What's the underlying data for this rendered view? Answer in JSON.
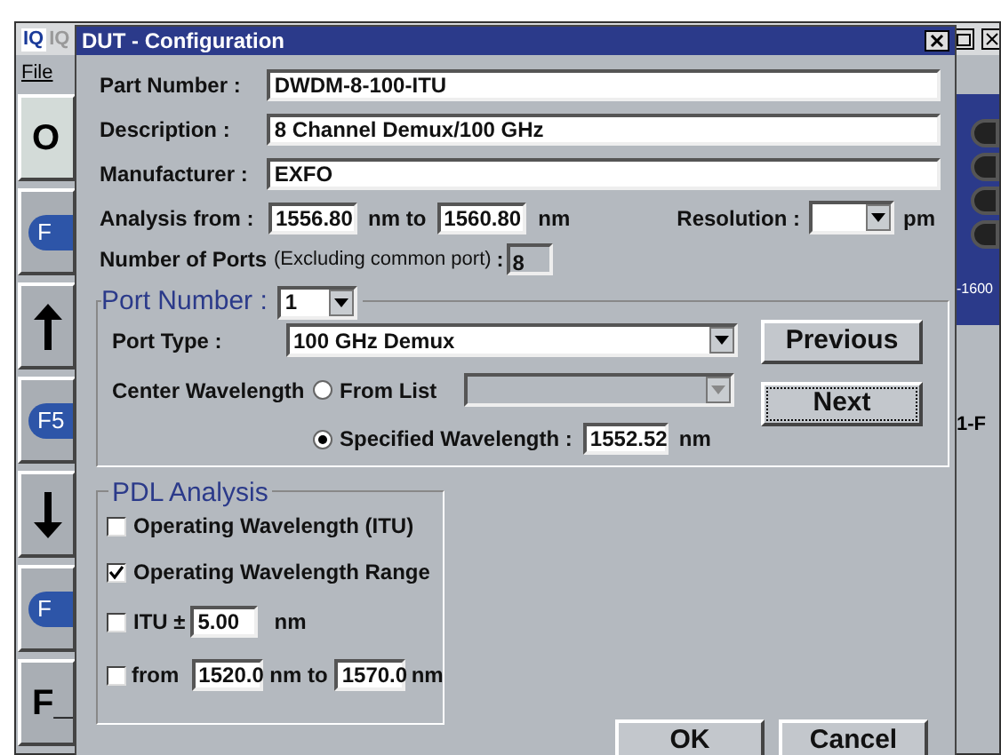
{
  "app": {
    "logo": "IQ",
    "title": "IQ",
    "menu": [
      "File"
    ],
    "side_buttons": [
      {
        "kind": "text",
        "label": "O"
      },
      {
        "kind": "pill",
        "label": "F"
      },
      {
        "kind": "arrow_up"
      },
      {
        "kind": "pill",
        "label": "F5"
      },
      {
        "kind": "arrow_down"
      },
      {
        "kind": "pill",
        "label": "F"
      },
      {
        "kind": "text",
        "label": "F_"
      }
    ],
    "right_labels": [
      "-1600",
      "1-F"
    ]
  },
  "dialog": {
    "title": "DUT - Configuration",
    "fields": [
      {
        "label": "Part Number :",
        "value": "DWDM-8-100-ITU"
      },
      {
        "label": "Description :",
        "value": "8 Channel Demux/100 GHz"
      },
      {
        "label": "Manufacturer :",
        "value": "EXFO"
      }
    ],
    "analysis": {
      "label": "Analysis from :",
      "from": "1556.80",
      "to_label": "nm to",
      "to": "1560.80",
      "unit": "nm",
      "resolution_label": "Resolution :",
      "resolution_unit": "pm"
    },
    "ports": {
      "label": "Number of Ports",
      "note": "(Excluding common port)",
      "colon": ":",
      "value": "8"
    },
    "port_group": {
      "title": "Port Number :",
      "port": "1",
      "type_label": "Port Type :",
      "type": "100 GHz Demux",
      "center_label": "Center Wavelength",
      "options": [
        {
          "label": "From List",
          "selected": false
        },
        {
          "label": "Specified Wavelength :",
          "selected": true
        }
      ],
      "wavelength": "1552.52",
      "unit": "nm",
      "buttons": [
        {
          "label": "Previous",
          "focused": false
        },
        {
          "label": "Next",
          "focused": true
        }
      ]
    },
    "pdl": {
      "title": "PDL Analysis",
      "options": [
        {
          "kind": "plain",
          "label": "Operating Wavelength (ITU)",
          "checked": false
        },
        {
          "kind": "plain",
          "label": "Operating Wavelength Range",
          "checked": true
        },
        {
          "kind": "itu",
          "label": "ITU ±",
          "value": "5.00",
          "unit": "nm",
          "checked": false
        },
        {
          "kind": "range",
          "label": "from",
          "from": "1520.0",
          "to_label": "nm to",
          "to": "1570.0",
          "unit": "nm",
          "checked": false
        }
      ]
    },
    "buttons": [
      "OK",
      "Cancel"
    ]
  }
}
